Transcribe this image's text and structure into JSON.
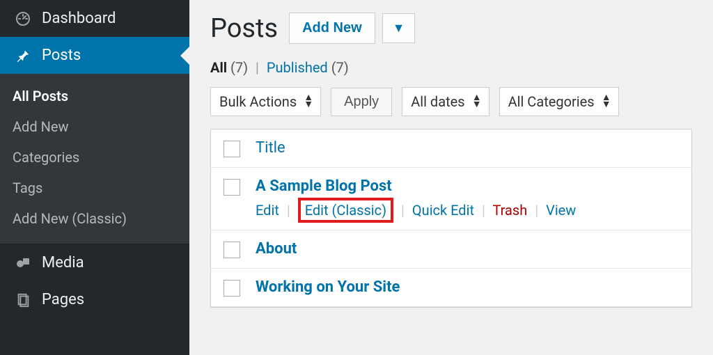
{
  "sidebar": {
    "dashboard": "Dashboard",
    "posts": "Posts",
    "media": "Media",
    "pages": "Pages",
    "submenu": {
      "all_posts": "All Posts",
      "add_new": "Add New",
      "categories": "Categories",
      "tags": "Tags",
      "add_new_classic": "Add New (Classic)"
    }
  },
  "header": {
    "title": "Posts",
    "add_new": "Add New"
  },
  "filters": {
    "all_label": "All",
    "all_count": "(7)",
    "published_label": "Published",
    "published_count": "(7)",
    "bulk_actions": "Bulk Actions",
    "apply": "Apply",
    "all_dates": "All dates",
    "all_categories": "All Categories"
  },
  "table": {
    "title_col": "Title",
    "rows": [
      {
        "title": "A Sample Blog Post"
      },
      {
        "title": "About"
      },
      {
        "title": "Working on Your Site"
      }
    ],
    "actions": {
      "edit": "Edit",
      "edit_classic": "Edit (Classic)",
      "quick_edit": "Quick Edit",
      "trash": "Trash",
      "view": "View"
    }
  }
}
